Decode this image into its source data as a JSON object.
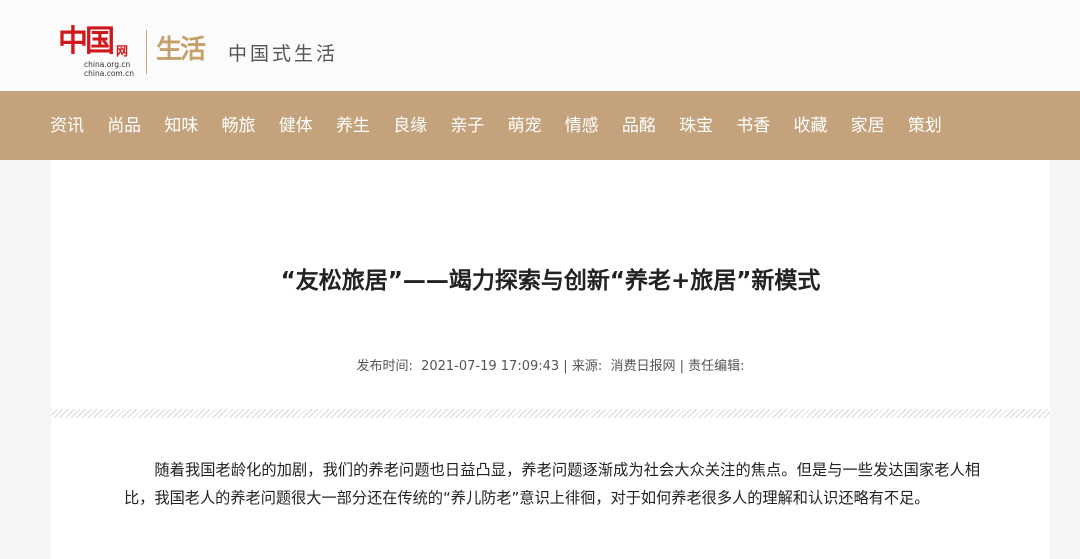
{
  "header": {
    "logo_mark": "中国",
    "logo_wang": "网",
    "logo_url": "china.org.cn\nchina.com.cn",
    "section_mark": "生活",
    "section_sub": "中国式生活"
  },
  "nav": {
    "items": [
      "资讯",
      "尚品",
      "知味",
      "畅旅",
      "健体",
      "养生",
      "良缘",
      "亲子",
      "萌宠",
      "情感",
      "品酩",
      "珠宝",
      "书香",
      "收藏",
      "家居",
      "策划"
    ]
  },
  "article": {
    "title": "“友松旅居”——竭力探索与创新“养老+旅居”新模式",
    "meta": {
      "published_label": "发布时间:",
      "published_value": "2021-07-19 17:09:43",
      "source_label": "来源:",
      "source_value": "消费日报网",
      "editor_label": "责任编辑:"
    },
    "paragraph": "随着我国老龄化的加剧，我们的养老问题也日益凸显，养老问题逐渐成为社会大众关注的焦点。但是与一些发达国家老人相比，我国老人的养老问题很大一部分还在传统的“养儿防老”意识上徘徊，对于如何养老很多人的理解和认识还略有不足。"
  }
}
